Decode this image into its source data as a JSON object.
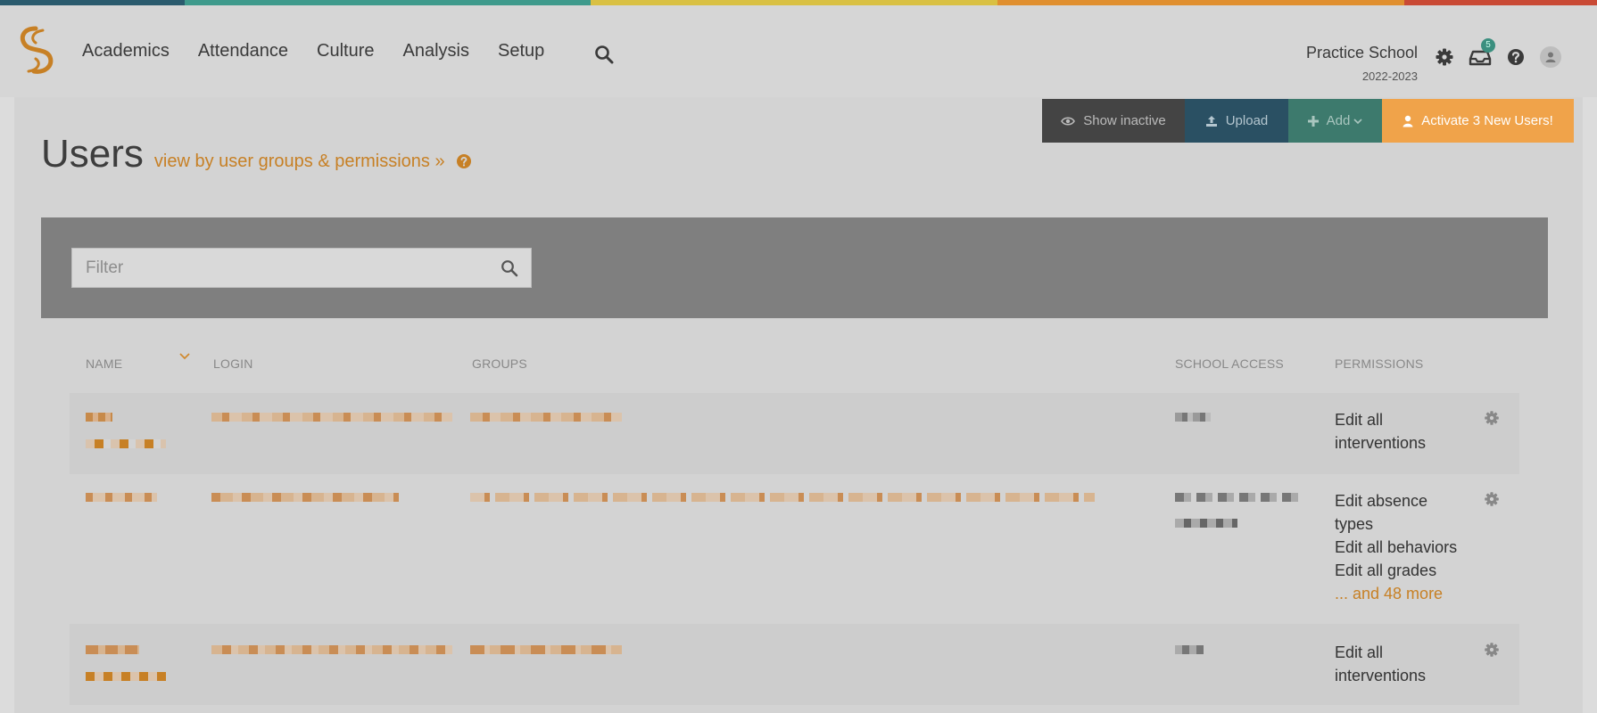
{
  "colors": {
    "stripe": [
      "#2b5b6e",
      "#3f9a8c",
      "#d9c043",
      "#e08f2f",
      "#c94a35"
    ],
    "accent": "#c78025",
    "activate": "#f0a34a"
  },
  "nav": {
    "items": [
      "Academics",
      "Attendance",
      "Culture",
      "Analysis",
      "Setup"
    ],
    "school_name": "Practice School",
    "school_year": "2022-2023",
    "inbox_count": "5",
    "icons": [
      "search-icon",
      "gear-icon",
      "inbox-icon",
      "help-icon",
      "user-avatar-icon"
    ]
  },
  "toolbar": {
    "show_inactive": "Show inactive",
    "upload": "Upload",
    "add": "Add",
    "activate": "Activate 3 New Users!"
  },
  "page": {
    "title": "Users",
    "groups_link": "view by user groups & permissions »"
  },
  "filter": {
    "placeholder": "Filter"
  },
  "table": {
    "columns": [
      "NAME",
      "LOGIN",
      "GROUPS",
      "SCHOOL ACCESS",
      "PERMISSIONS"
    ],
    "rows": [
      {
        "permissions": [
          "Edit all",
          "interventions"
        ],
        "more": ""
      },
      {
        "permissions": [
          "Edit absence",
          "types",
          "Edit all behaviors",
          "Edit all grades"
        ],
        "more": "... and 48 more"
      },
      {
        "permissions": [
          "Edit all",
          "interventions"
        ],
        "more": ""
      }
    ]
  }
}
